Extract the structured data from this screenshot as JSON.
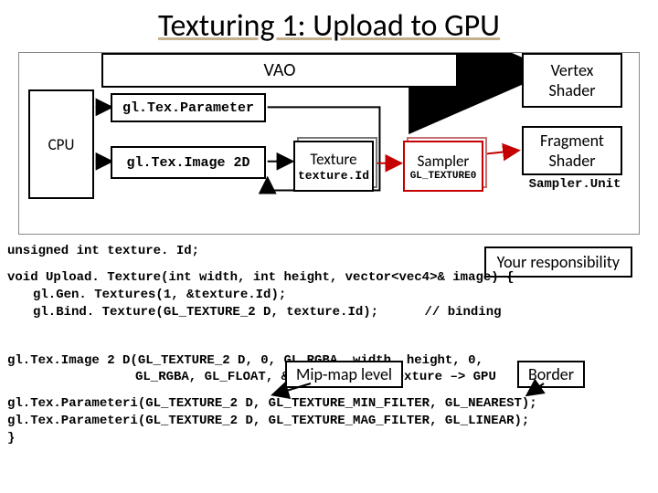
{
  "title": "Texturing 1: Upload to GPU",
  "diagram": {
    "cpu": "CPU",
    "vao": "VAO",
    "texParameter": "gl.Tex.Parameter",
    "texImage2D": "gl.Tex.Image 2D",
    "texture": {
      "label": "Texture",
      "sub": "texture.Id"
    },
    "sampler": {
      "label": "Sampler",
      "sub": "GL_TEXTURE0"
    },
    "vertexShader_l1": "Vertex",
    "vertexShader_l2": "Shader",
    "fragmentShader_l1": "Fragment",
    "fragmentShader_l2": "Shader",
    "samplerUnit": "Sampler.Unit"
  },
  "responsibility": "Your responsibility",
  "annotations": {
    "mipmap": "Mip-map level",
    "border": "Border"
  },
  "code": {
    "l1": "unsigned int texture. Id;",
    "l2": "void Upload. Texture(int width, int height, vector<vec4>& image) {",
    "l3": "gl.Gen. Textures(1, &texture.Id);",
    "l4_a": "gl.Bind. Texture(GL_TEXTURE_2 D, texture.Id);",
    "l4_b": "// binding",
    "l5": "gl.Tex.Image 2 D(GL_TEXTURE_2 D, 0, GL_RGBA, width, height, 0,",
    "l6": "GL_RGBA, GL_FLOAT, &image[0]); //Texture –> GPU",
    "l7": "gl.Tex.Parameteri(GL_TEXTURE_2 D, GL_TEXTURE_MIN_FILTER, GL_NEAREST);",
    "l8": "gl.Tex.Parameteri(GL_TEXTURE_2 D, GL_TEXTURE_MAG_FILTER, GL_LINEAR);",
    "l9": "}"
  }
}
